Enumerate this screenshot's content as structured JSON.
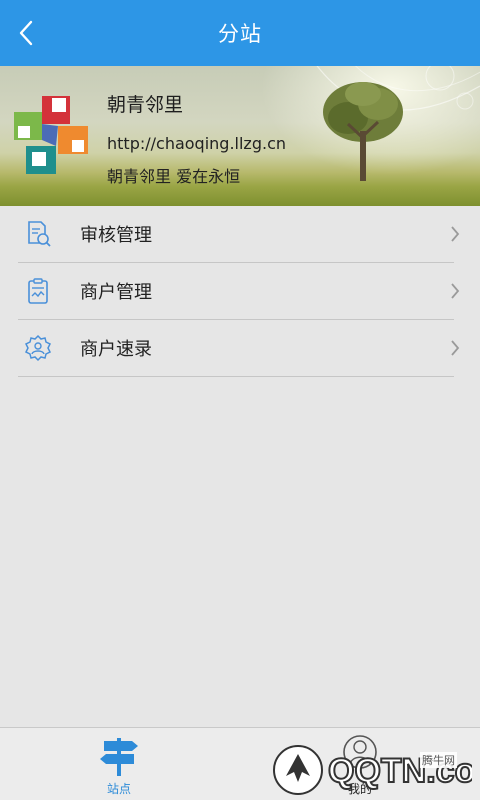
{
  "header": {
    "title": "分站",
    "back_icon": "back-arrow-icon"
  },
  "banner": {
    "name": "朝青邻里",
    "url": "http://chaoqing.llzg.cn",
    "slogan": "朝青邻里 爱在永恒"
  },
  "menu": [
    {
      "label": "审核管理",
      "icon": "audit-document-icon"
    },
    {
      "label": "商户管理",
      "icon": "clipboard-icon"
    },
    {
      "label": "商户速录",
      "icon": "gear-people-icon"
    }
  ],
  "tabbar": {
    "tabs": [
      {
        "label": "站点",
        "icon": "signpost-icon",
        "active": true
      },
      {
        "label": "我的",
        "icon": "user-icon",
        "active": false
      }
    ]
  },
  "watermark": {
    "brand": "QQTN.com",
    "sub": "腾牛网"
  },
  "colors": {
    "primary": "#2d96e6",
    "background": "#e6e6e6",
    "active_tab": "#2d8bd8"
  }
}
